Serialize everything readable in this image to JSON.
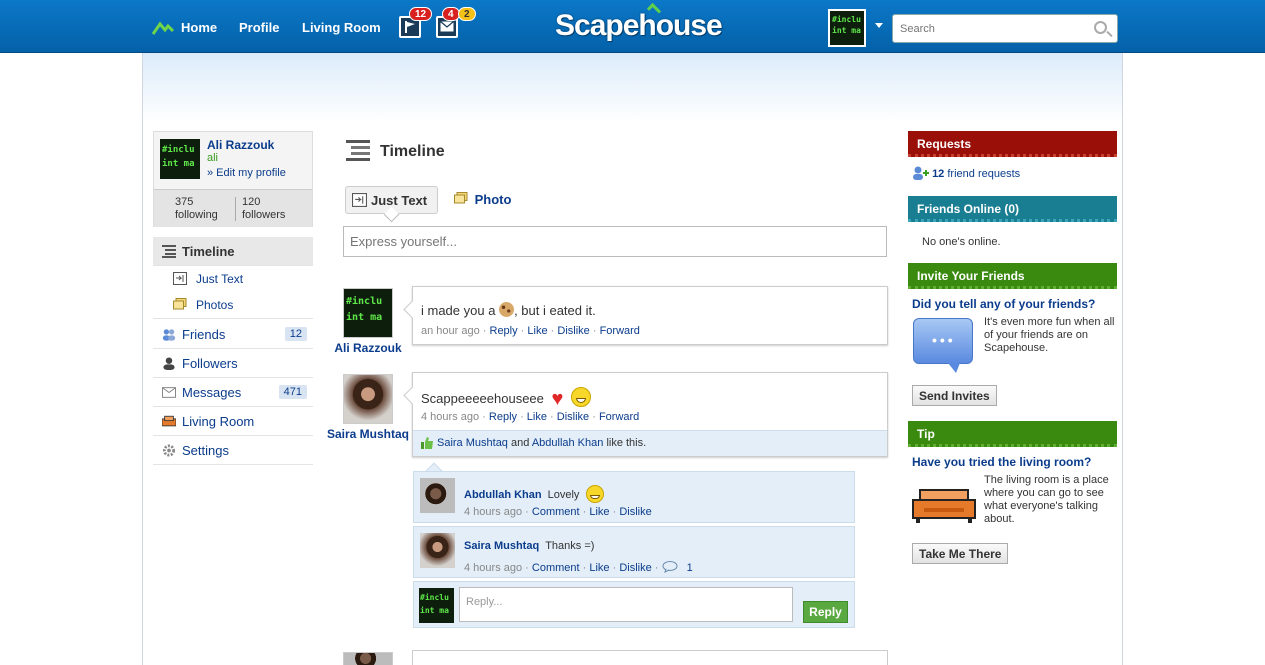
{
  "nav": {
    "home": "Home",
    "profile": "Profile",
    "living_room": "Living Room"
  },
  "notifications": {
    "flag_count": "12",
    "mail_count_red": "4",
    "mail_count_yellow": "2"
  },
  "brand": {
    "logo": "Scapehouse"
  },
  "search": {
    "placeholder": "Search"
  },
  "avatar_code": "#inclu\nint ma",
  "profile": {
    "name": "Ali  Razzouk",
    "username": "ali",
    "edit_link": "» Edit my profile",
    "following_count": "375",
    "following_label": "following",
    "followers_count": "120",
    "followers_label": "followers"
  },
  "sidebar": {
    "timeline": "Timeline",
    "just_text": "Just Text",
    "photos": "Photos",
    "friends": "Friends",
    "friends_count": "12",
    "followers": "Followers",
    "messages": "Messages",
    "messages_count": "471",
    "living_room": "Living Room",
    "settings": "Settings"
  },
  "timeline": {
    "title": "Timeline",
    "tab_text": "Just Text",
    "tab_photo": "Photo",
    "express_placeholder": "Express yourself..."
  },
  "posts": [
    {
      "author": "Ali  Razzouk",
      "text_before": "i made you a",
      "text_after": ", but i eated it.",
      "time": "an hour ago",
      "reply": "Reply",
      "like": "Like",
      "dislike": "Dislike",
      "forward": "Forward"
    },
    {
      "author": "Saira Mushtaq",
      "text": "Scappeeeeehouseee",
      "time": "4 hours ago",
      "reply": "Reply",
      "like": "Like",
      "dislike": "Dislike",
      "forward": "Forward",
      "liker1": "Saira Mushtaq",
      "and": "and",
      "liker2": "Abdullah Khan",
      "like_suffix": "like this."
    }
  ],
  "comments": [
    {
      "author": "Abdullah Khan",
      "text": "Lovely",
      "time": "4 hours ago",
      "comment": "Comment",
      "like": "Like",
      "dislike": "Dislike"
    },
    {
      "author": "Saira Mushtaq",
      "text": "Thanks =)",
      "time": "4 hours ago",
      "comment": "Comment",
      "like": "Like",
      "dislike": "Dislike",
      "replies": "1"
    }
  ],
  "reply_box": {
    "placeholder": "Reply...",
    "button": "Reply"
  },
  "right": {
    "requests_title": "Requests",
    "requests_count": "12",
    "requests_label": "friend requests",
    "online_title": "Friends Online  (0)",
    "online_text": "No one's online.",
    "invite_title": "Invite Your Friends",
    "invite_question": "Did you tell any of your friends?",
    "invite_text": "It's even more fun when all of your friends are on Scapehouse.",
    "invite_button": "Send Invites",
    "tip_title": "Tip",
    "tip_question": "Have you tried the living room?",
    "tip_text": "The living room is a place where you can go to see what everyone's talking about.",
    "tip_button": "Take Me There"
  }
}
